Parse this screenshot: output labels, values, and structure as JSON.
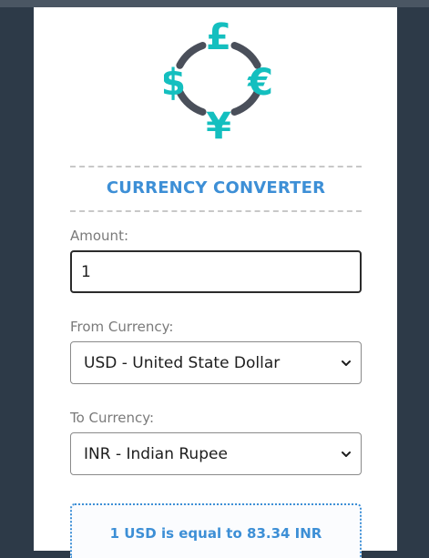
{
  "header": {
    "title": "CURRENCY CONVERTER"
  },
  "logo": {
    "symbols": [
      "£",
      "$",
      "€",
      "¥"
    ],
    "color": "#14bfbf",
    "ring_color": "#4a4f5a"
  },
  "amount": {
    "label": "Amount:",
    "value": "1"
  },
  "from_currency": {
    "label": "From Currency:",
    "selected": "USD - United State Dollar"
  },
  "to_currency": {
    "label": "To Currency:",
    "selected": "INR - Indian Rupee"
  },
  "result": {
    "text": "1 USD is equal to 83.34 INR"
  },
  "colors": {
    "accent": "#3d8fd6",
    "page_bg": "#2d3a48"
  }
}
